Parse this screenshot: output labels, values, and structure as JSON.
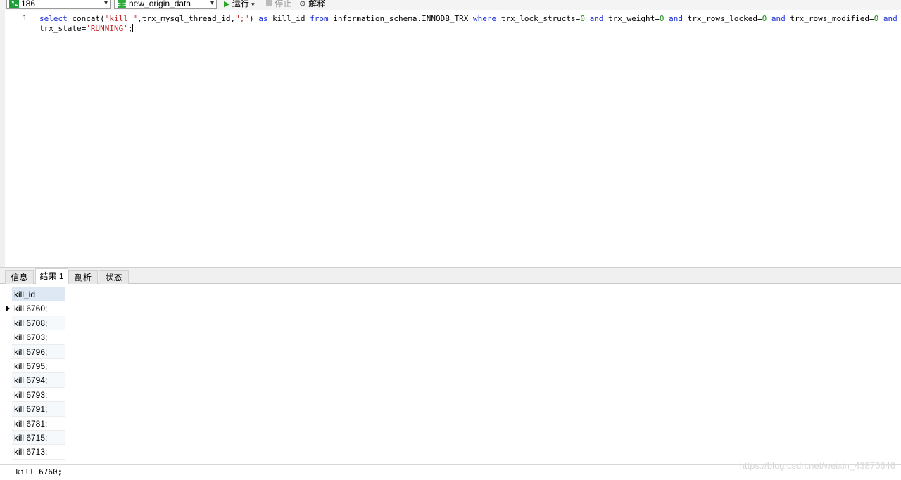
{
  "toolbar": {
    "connection": "186",
    "database": "new_origin_data",
    "run_label": "运行",
    "stop_label": "停止",
    "explain_label": "解释"
  },
  "editor": {
    "line_number": "1"
  },
  "result_tabs": [
    "信息",
    "结果 1",
    "剖析",
    "状态"
  ],
  "result_table": {
    "column": "kill_id",
    "rows": [
      "kill 6760;",
      "kill 6708;",
      "kill 6703;",
      "kill 6796;",
      "kill 6795;",
      "kill 6794;",
      "kill 6793;",
      "kill 6791;",
      "kill 6781;",
      "kill 6715;",
      "kill 6713;"
    ]
  },
  "status_bar": {
    "query_text": "kill 6760;",
    "watermark": "https://blog.csdn.net/weixin_43870646"
  }
}
